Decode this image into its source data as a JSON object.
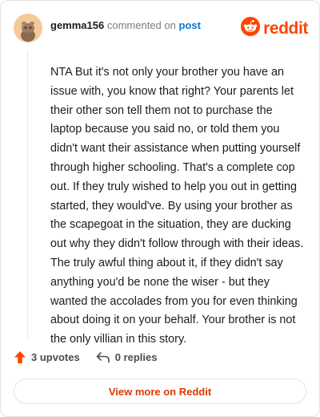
{
  "comment": {
    "username": "gemma156",
    "action_text": "commented on",
    "post_link_label": "post",
    "body": "NTA But it's not only your brother you have an issue with, you know that right? Your parents let their other son tell them not to purchase the laptop because you said no, or told them you didn't want their assistance when putting yourself through higher schooling. That's a complete cop out. If they truly wished to help you out in getting started, they would've. By using your brother as the scapegoat in the situation, they are ducking out why they didn't follow through with their ideas. The truly awful thing about it, if they didn't say anything you'd be none the wiser - but they wanted the accolades from you for even thinking about doing it on your behalf. Your brother is not the only villian in this story."
  },
  "brand": {
    "name": "reddit",
    "icon": "reddit-snoo-icon",
    "color": "#ff4500"
  },
  "footer": {
    "upvotes_label": "3 upvotes",
    "replies_label": "0 replies",
    "upvote_icon": "upvote-arrow-icon",
    "reply_icon": "reply-arrow-icon",
    "upvote_color": "#ff4500"
  },
  "cta": {
    "view_more_label": "View more on Reddit",
    "color": "#d93a00"
  },
  "avatar": {
    "icon": "user-avatar-icon",
    "background": "#f6c99c"
  }
}
